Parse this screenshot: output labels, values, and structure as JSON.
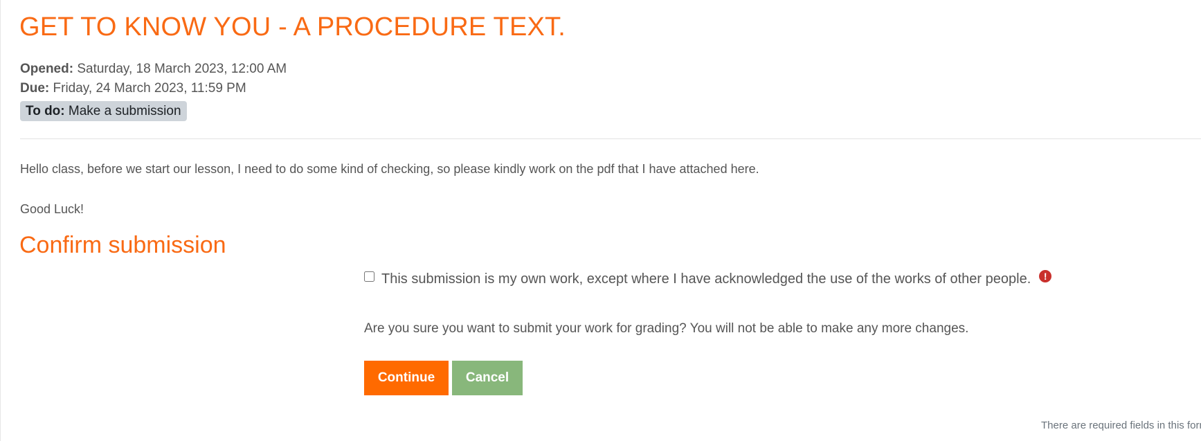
{
  "assignment": {
    "title": "GET TO KNOW YOU - A PROCEDURE TEXT.",
    "opened_label": "Opened:",
    "opened_value": "Saturday, 18 March 2023, 12:00 AM",
    "due_label": "Due:",
    "due_value": "Friday, 24 March 2023, 11:59 PM",
    "todo_label": "To do:",
    "todo_value": "Make a submission"
  },
  "description": {
    "intro": "Hello class, before we start our lesson, I need to do some kind of checking, so please kindly work on the pdf that I have attached here.",
    "closing": "Good Luck!"
  },
  "confirm": {
    "heading": "Confirm submission",
    "statement_label": "This submission is my own work, except where I have acknowledged the use of the works of other people.",
    "statement_checked": false,
    "required_icon": "exclamation-circle-icon",
    "question": "Are you sure you want to submit your work for grading? You will not be able to make any more changes.",
    "continue_label": "Continue",
    "cancel_label": "Cancel",
    "required_note": "There are required fields in this form"
  },
  "colors": {
    "heading": "#f96a14",
    "continue_button": "#ff6a00",
    "cancel_button": "#88b77b",
    "required_icon": "#c9302c",
    "badge_bg": "#ced4da"
  }
}
